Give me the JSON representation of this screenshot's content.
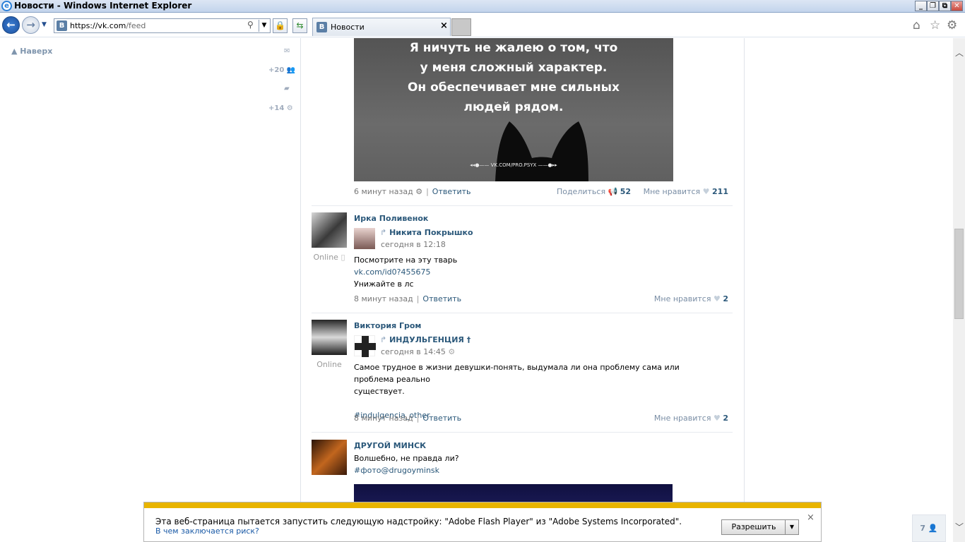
{
  "window": {
    "title": "Новости - Windows Internet Explorer",
    "minimize": "_",
    "maximize": "❐",
    "close": "✕"
  },
  "browser": {
    "back_icon": "←",
    "forward_icon": "→",
    "url_host": "https://vk.com",
    "url_path": "/feed",
    "favicon": "B",
    "tab_label": "Новости",
    "tab_close": "×"
  },
  "sidebar": {
    "up_label": "▲ Наверх",
    "messages_icon": "✉",
    "friends_count": "+20",
    "comments_icon": "💬",
    "settings_count": "+14"
  },
  "posts": [
    {
      "image_text": [
        "Я ничуть не жалею о том, что",
        "у меня сложный характер.",
        "Он обеспечивает мне сильных",
        "людей рядом."
      ],
      "image_watermark": "◂◂●—— VK.COM/PRO.PSYX ——●▸▸",
      "time": "6 минут назад",
      "reply": "Ответить",
      "share_label": "Поделиться",
      "share_count": "52",
      "like_label": "Мне нравится",
      "like_count": "211"
    },
    {
      "author": "Ирка Поливенок",
      "online": "Online",
      "repost_author": "Никита Покрышко",
      "repost_time": "сегодня в 12:18",
      "text1": "Посмотрите на эту тварь",
      "link": "vk.com/id0?455675",
      "text2": "Унижайте в лс",
      "time": "8 минут назад",
      "reply": "Ответить",
      "like_label": "Мне нравится",
      "like_count": "2"
    },
    {
      "author": "Виктория Гром",
      "online": "Online",
      "repost_author": "ИНДУЛЬГЕНЦИЯ †",
      "repost_time": "сегодня в 14:45",
      "text1": "Самое трудное в жизни девушки-понять, выдумала ли она проблему сама или проблема реально",
      "text1b": "существует.",
      "hashtag": "#indulgencia_other",
      "time": "8 минут назад",
      "reply": "Ответить",
      "like_label": "Мне нравится",
      "like_count": "2"
    },
    {
      "author": "ДРУГОЙ МИНСК",
      "text1": "Волшебно, не правда ли?",
      "hashtag": "#фото@drugoyminsk"
    }
  ],
  "flash_bar": {
    "message": "Эта веб-страница пытается запустить следующую надстройку: \"Adobe Flash Player\" из \"Adobe Systems Incorporated\".",
    "risk_link": "В чем заключается риск?",
    "allow_button": "Разрешить",
    "close": "×"
  },
  "chat_count": "7"
}
